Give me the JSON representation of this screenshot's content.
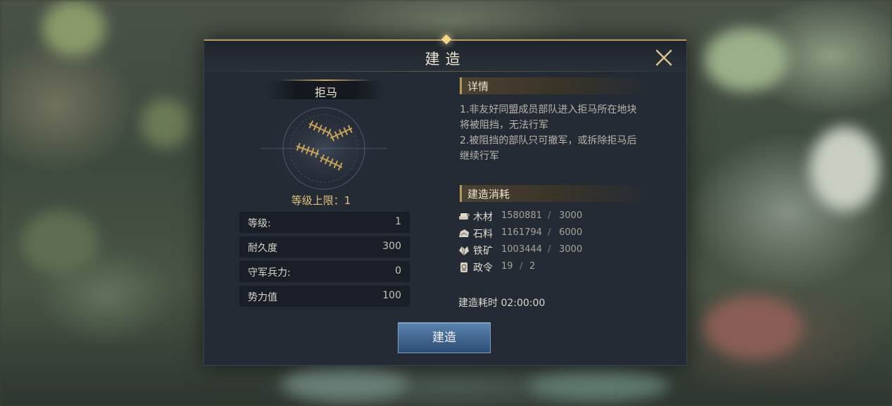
{
  "dialog": {
    "title": "建造",
    "close_icon": "close-icon"
  },
  "structure": {
    "name": "拒马",
    "image_icon": "barricade-icon",
    "level_cap_label": "等级上限：1"
  },
  "stats": [
    {
      "label": "等级:",
      "value": "1"
    },
    {
      "label": "耐久度",
      "value": "300"
    },
    {
      "label": "守军兵力:",
      "value": "0"
    },
    {
      "label": "势力值",
      "value": "100"
    }
  ],
  "details": {
    "header": "详情",
    "line1a": "1.非友好同盟成员部队进入拒马所在地块",
    "line1b": "将被阻挡，无法行军",
    "line2a": "2.被阻挡的部队只可撤军，或拆除拒马后",
    "line2b": "继续行军"
  },
  "cost": {
    "header": "建造消耗",
    "items": [
      {
        "icon": "wood-icon",
        "name": "木材",
        "have": "1580881",
        "sep": "/",
        "need": "3000"
      },
      {
        "icon": "stone-icon",
        "name": "石料",
        "have": "1161794",
        "sep": "/",
        "need": "6000"
      },
      {
        "icon": "iron-ore-icon",
        "name": "铁矿",
        "have": "1003444",
        "sep": "/",
        "need": "3000"
      },
      {
        "icon": "decree-icon",
        "name": "政令",
        "have": "19",
        "sep": "/",
        "need": "2"
      }
    ],
    "time": "建造耗时 02:00:00"
  },
  "actions": {
    "build_label": "建造"
  },
  "colors": {
    "gold_accent": "#b89a5c",
    "level_cap": "#e0c27a",
    "button_blue": "#41658e"
  }
}
